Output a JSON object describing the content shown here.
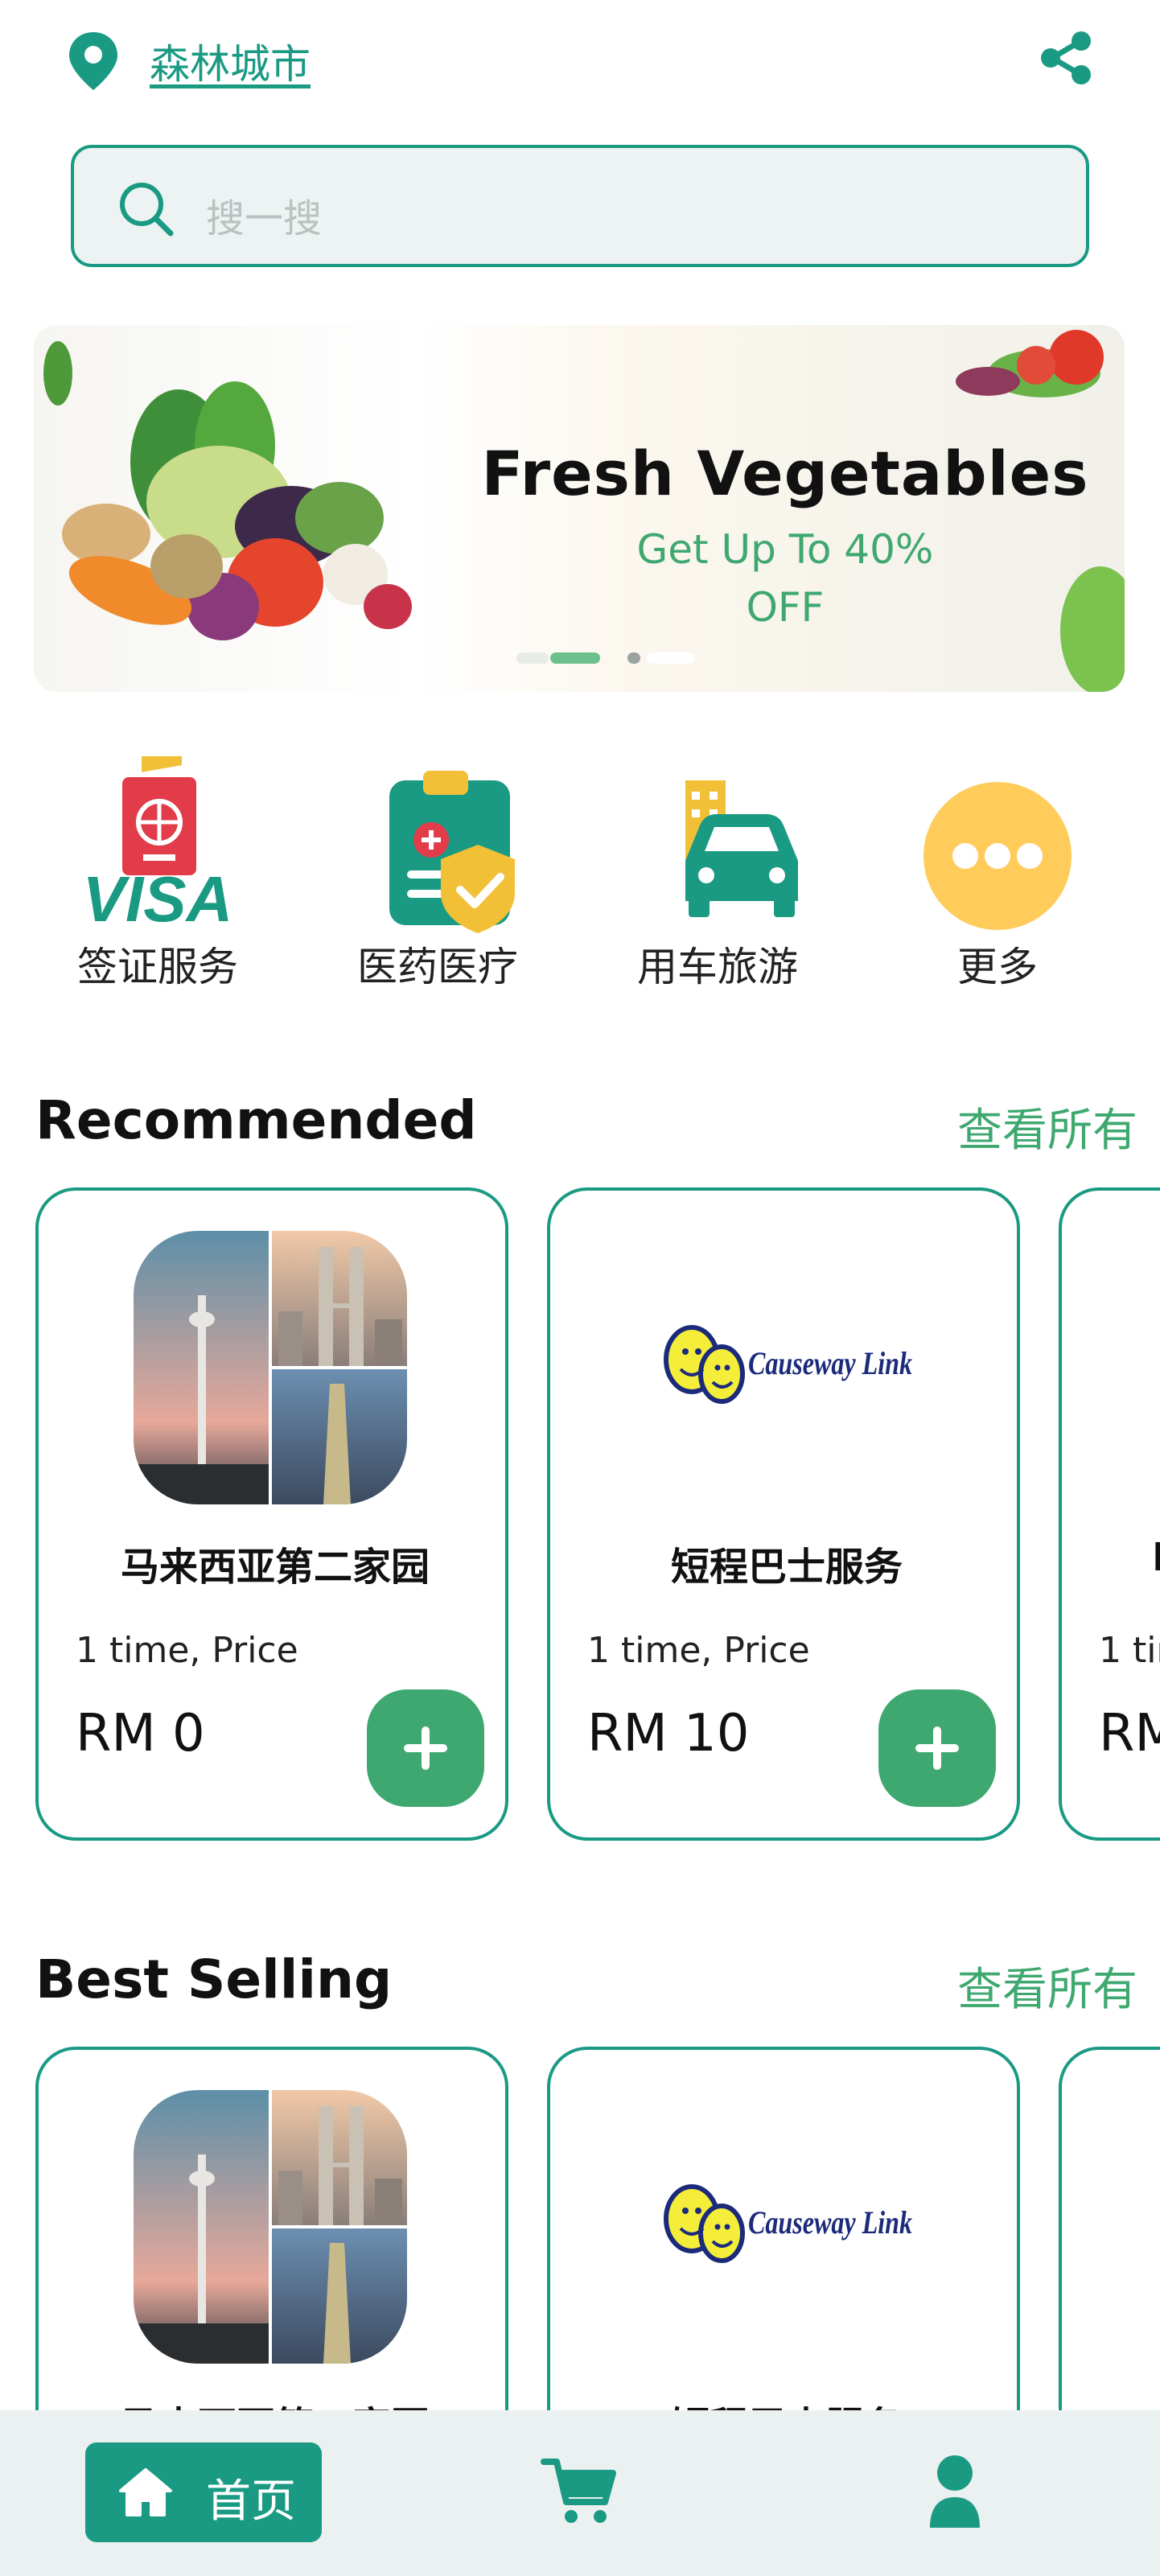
{
  "header": {
    "location": "森林城市",
    "location_icon": "map-pin-icon",
    "share_icon": "share-icon"
  },
  "search": {
    "placeholder": "搜一搜",
    "icon": "search-icon"
  },
  "banner": {
    "title": "Fresh Vegetables",
    "subtitle_line1": "Get Up To 40%",
    "subtitle_line2": "OFF",
    "active_slide": 1,
    "slide_count": 3
  },
  "categories": [
    {
      "label": "签证服务",
      "icon": "visa-passport-icon"
    },
    {
      "label": "医药医疗",
      "icon": "medical-clipboard-icon"
    },
    {
      "label": "用车旅游",
      "icon": "car-travel-icon"
    },
    {
      "label": "更多",
      "icon": "more-dots-icon"
    }
  ],
  "recommended": {
    "title": "Recommended",
    "view_all": "查看所有",
    "items": [
      {
        "name": "马来西亚第二家园",
        "sub": "1 time, Price",
        "price": "RM 0",
        "image": "kuala-lumpur-collage"
      },
      {
        "name": "短程巴士服务",
        "sub": "1 time, Price",
        "price": "RM 10",
        "image": "causeway-link-logo"
      },
      {
        "name": "M",
        "sub": "1 tir",
        "price": "RM",
        "image": "partial"
      }
    ]
  },
  "best_selling": {
    "title": "Best Selling",
    "view_all": "查看所有",
    "items": [
      {
        "name": "马来西亚第二家园",
        "image": "kuala-lumpur-collage"
      },
      {
        "name": "短程巴士服务",
        "image": "causeway-link-logo"
      },
      {
        "name": "",
        "image": "partial"
      }
    ]
  },
  "logo_text": "Causeway Link",
  "bottom_nav": {
    "home_label": "首页",
    "home_icon": "home-icon",
    "cart_icon": "cart-icon",
    "profile_icon": "user-icon"
  },
  "colors": {
    "primary": "#1a9a83",
    "accent_green": "#3fa870",
    "search_bg": "#ecf3f2",
    "nav_bg": "#eaf1f0"
  }
}
